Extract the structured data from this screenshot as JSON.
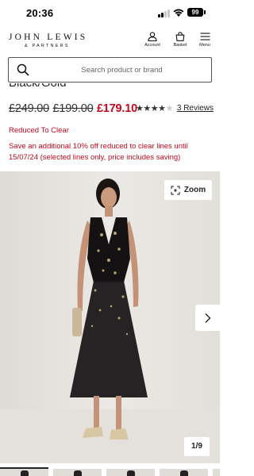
{
  "status_bar": {
    "time": "20:36",
    "battery": "99"
  },
  "header": {
    "logo_main": "JOHN LEWIS",
    "logo_sub": "& PARTNERS",
    "account_label": "Account",
    "basket_label": "Basket",
    "menu_label": "Menu"
  },
  "search": {
    "placeholder": "Search product or brand"
  },
  "product": {
    "title": "Black/Gold",
    "price_original": "£249.00",
    "price_previous": "£199.00",
    "price_current": "£179.10",
    "rating_stars": 4,
    "reviews_link": "3 Reviews",
    "reduced_label": "Reduced To Clear",
    "promo_text": "Save an additional 10% off reduced to clear lines until 15/07/24 (selected lines only, price includes saving)"
  },
  "gallery": {
    "zoom_label": "Zoom",
    "counter": "1/9",
    "current_image": 1,
    "total_images": 9
  },
  "colors": {
    "sale_red": "#c00a1f",
    "text_dark": "#222222",
    "image_background": "#e8e6e2"
  }
}
